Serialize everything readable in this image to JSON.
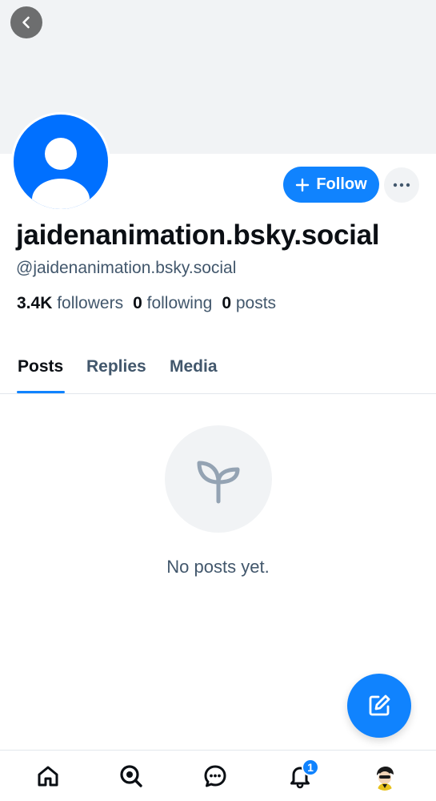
{
  "profile": {
    "display_name": "jaidenanimation.bsky.social",
    "handle": "@jaidenanimation.bsky.social",
    "stats": {
      "followers_count": "3.4K",
      "followers_label": "followers",
      "following_count": "0",
      "following_label": "following",
      "posts_count": "0",
      "posts_label": "posts"
    }
  },
  "actions": {
    "follow_label": "Follow"
  },
  "tabs": [
    {
      "label": "Posts",
      "active": true
    },
    {
      "label": "Replies",
      "active": false
    },
    {
      "label": "Media",
      "active": false
    }
  ],
  "feed": {
    "empty_message": "No posts yet."
  },
  "bottom_nav": {
    "notifications_badge": "1",
    "items": [
      "home-icon",
      "search-icon",
      "chat-icon",
      "bell-icon",
      "profile-avatar"
    ]
  },
  "colors": {
    "accent": "#1083fe",
    "avatar_bg": "#0070ff",
    "muted_text": "#42576c",
    "banner_bg": "#f1f3f5"
  }
}
